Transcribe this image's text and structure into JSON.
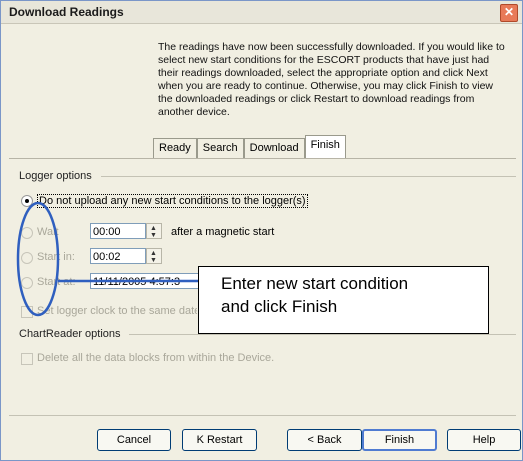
{
  "window": {
    "title": "Download Readings",
    "close_symbol": "✕",
    "intro_text": "The readings have now been successfully downloaded. If you would like to select new start conditions for the ESCORT products that have just had their readings downloaded, select the appropriate option and click Next when you are ready to continue. Otherwise, you may click Finish to view the downloaded readings or click Restart to download readings from another device."
  },
  "tabs": [
    {
      "label": "Ready"
    },
    {
      "label": "Search"
    },
    {
      "label": "Download"
    },
    {
      "label": "Finish",
      "active": true
    }
  ],
  "logger_options": {
    "title": "Logger options",
    "selected_option": "Do not upload any new start conditions to the logger(s)",
    "wait_label": "Wait",
    "wait_value": "00:00",
    "wait_suffix": "after a magnetic start",
    "start_in_label": "Start in:",
    "start_in_value": "00:02",
    "start_at_label": "Start at:",
    "start_at_value": "11/11/2005  4:57:3",
    "clock_label": "Set logger clock to the same date"
  },
  "chartreader_options": {
    "title": "ChartReader options",
    "delete_label": "Delete all the data blocks from within the Device."
  },
  "callout": {
    "line1": "Enter new start condition",
    "line2": "and click Finish"
  },
  "buttons": {
    "cancel": "Cancel",
    "restart": "K Restart",
    "back": "< Back",
    "finish": "Finish",
    "help": "Help"
  },
  "colors": {
    "annotation": "#2f5fbf",
    "window_bg": "#f1efe2"
  }
}
